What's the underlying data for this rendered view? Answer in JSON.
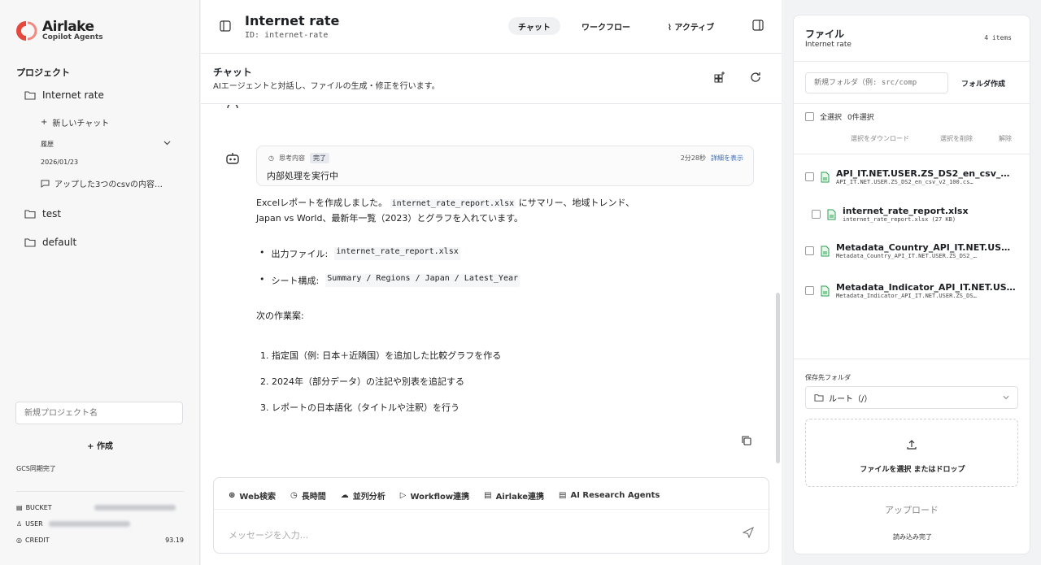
{
  "app": {
    "logo_name": "Airlake",
    "logo_sub": "Copilot Agents",
    "brand_color": "#e5483d"
  },
  "sidebar": {
    "section_title": "プロジェクト",
    "projects": [
      {
        "label": "Internet rate"
      },
      {
        "label": "test"
      },
      {
        "label": "default"
      }
    ],
    "new_chat": "新しいチャット",
    "history_label": "履歴",
    "history_date": "2026/01/23",
    "history_item": "アップした3つのcsvの内容…",
    "new_project_placeholder": "新規プロジェクト名",
    "create_label": "作成",
    "gcs_status": "GCS同期完了",
    "meta": {
      "bucket_key": "BUCKET",
      "user_key": "USER",
      "credit_key": "CREDIT",
      "credit_value": "93.19"
    }
  },
  "header": {
    "title": "Internet rate",
    "id_text": "ID: internet-rate",
    "tabs": [
      "チャット",
      "ワークフロー",
      "アクティブ"
    ],
    "active_tab": 0
  },
  "chat": {
    "title": "チャット",
    "description": "AIエージェントと対話し、ファイルの生成・修正を行います。",
    "thinking": {
      "label": "思考内容",
      "badge": "完了",
      "text": "内部処理を実行中",
      "time": "2分28秒",
      "details_link": "詳細を表示"
    },
    "message": {
      "intro_1": "Excelレポートを作成しました。",
      "intro_code": "internet_rate_report.xlsx",
      "intro_2": "にサマリー、地域トレンド、",
      "intro_line2": "Japan vs World、最新年一覧（2023）とグラフを入れています。",
      "bullet1_label": "出力ファイル:",
      "bullet1_code": "internet_rate_report.xlsx",
      "bullet2_label": "シート構成:",
      "bullet2_code": "Summary / Regions / Japan / Latest_Year",
      "next_title": "次の作業案:",
      "steps": [
        "1. 指定国（例: 日本＋近隣国）を追加した比較グラフを作る",
        "2. 2024年（部分データ）の注記や別表を追記する",
        "3. レポートの日本語化（タイトルや注釈）を行う"
      ]
    },
    "tools": [
      "Web検索",
      "長時間",
      "並列分析",
      "Workflow連携",
      "Airlake連携",
      "AI Research Agents"
    ],
    "input_placeholder": "メッセージを入力..."
  },
  "files": {
    "title": "ファイル",
    "subtitle": "Internet rate",
    "count": "4 items",
    "folder_placeholder": "新規フォルダ（例: src/comp",
    "folder_button": "フォルダ作成",
    "select_all": "全選択",
    "selected_count": "0件選択",
    "download_selected": "選択をダウンロード",
    "delete_selected": "選択を削除",
    "clear": "解除",
    "items": [
      {
        "name": "API_IT.NET.USER.ZS_DS2_en_csv_…",
        "sub": "API_IT.NET.USER.ZS_DS2_en_csv_v2_100.cs…"
      },
      {
        "name": "internet_rate_report.xlsx",
        "sub": "internet_rate_report.xlsx (27 KB)"
      },
      {
        "name": "Metadata_Country_API_IT.NET.US…",
        "sub": "Metadata_Country_API_IT.NET.USER.ZS_DS2_…"
      },
      {
        "name": "Metadata_Indicator_API_IT.NET.US…",
        "sub": "Metadata_Indicator_API_IT.NET.USER.ZS_DS…"
      }
    ],
    "save_folder_label": "保存先フォルダ",
    "save_folder_value": "ルート（/）",
    "drop_text": "ファイルを選択 またはドロップ",
    "upload_button": "アップロード",
    "loaded_status": "読み込み完了"
  }
}
